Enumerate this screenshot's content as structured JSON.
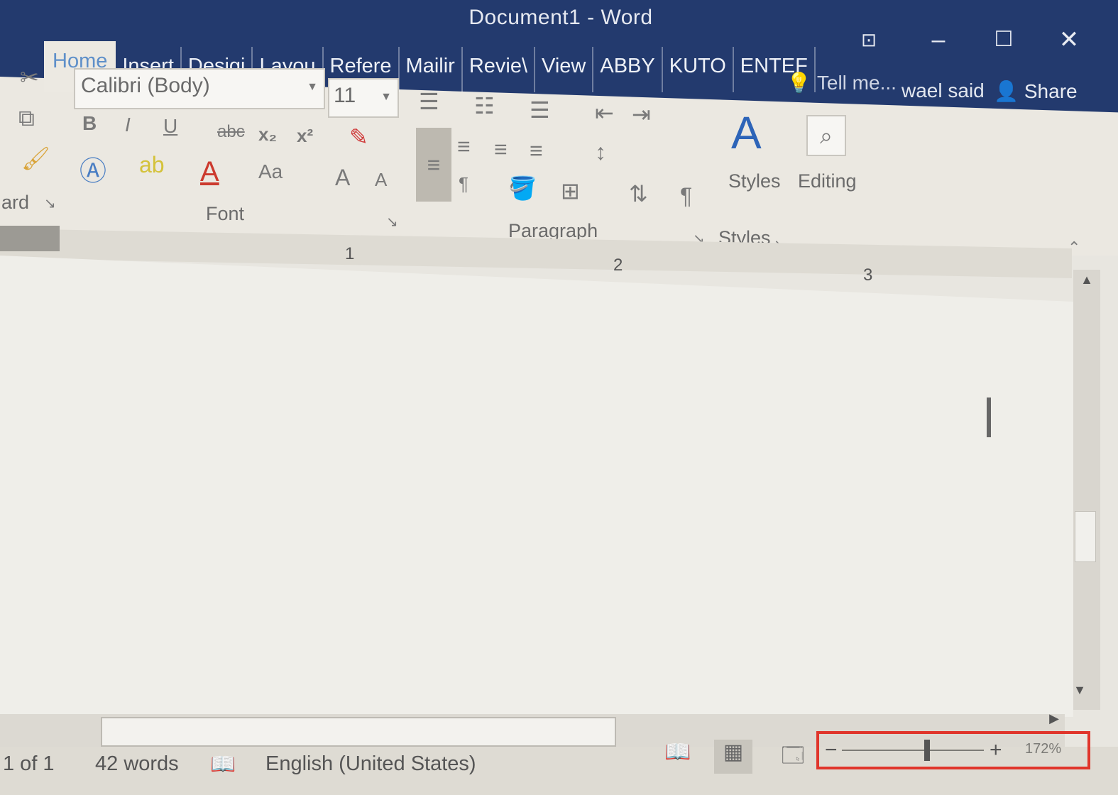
{
  "window": {
    "title": "Document1 - Word",
    "controls": {
      "ribbon_options": "⊡",
      "minimize": "–",
      "maximize": "☐",
      "close": "✕"
    }
  },
  "tabs": [
    {
      "label": "Home",
      "active": true
    },
    {
      "label": "Insert"
    },
    {
      "label": "Desigi"
    },
    {
      "label": "Layou"
    },
    {
      "label": "Refere"
    },
    {
      "label": "Mailir"
    },
    {
      "label": "Revie\\"
    },
    {
      "label": "View"
    },
    {
      "label": "ABBY"
    },
    {
      "label": "KUTO"
    },
    {
      "label": "ENTEF"
    }
  ],
  "tell_me": {
    "icon": "lightbulb-icon",
    "label": "Tell me..."
  },
  "user": {
    "name": "wael said"
  },
  "share": {
    "icon": "person-plus-icon",
    "label": "Share"
  },
  "ribbon": {
    "clipboard": {
      "group_label": "ard",
      "icons": [
        "cut-icon",
        "copy-icon",
        "format-painter-icon"
      ]
    },
    "font": {
      "group_label": "Font",
      "font_name": "Calibri (Body)",
      "font_size": "11",
      "bold": "B",
      "italic": "I",
      "underline": "U",
      "strikethrough": "abc",
      "subscript": "x₂",
      "superscript": "x²",
      "change_case": "Aa",
      "grow": "A",
      "shrink": "A"
    },
    "paragraph": {
      "group_label": "Paragraph"
    },
    "styles": {
      "group_label": "Styles",
      "button_label": "Styles"
    },
    "editing": {
      "button_label": "Editing"
    }
  },
  "ruler": {
    "marks": [
      "1",
      "2",
      "3"
    ]
  },
  "status": {
    "page": "1 of 1",
    "words": "42 words",
    "language": "English (United States)",
    "zoom": "172%",
    "zoom_level_fraction": 0.6
  },
  "colors": {
    "title_bar": "#233a6e",
    "zoom_highlight": "#e0352b",
    "active_tab_text": "#5e8fc9"
  }
}
